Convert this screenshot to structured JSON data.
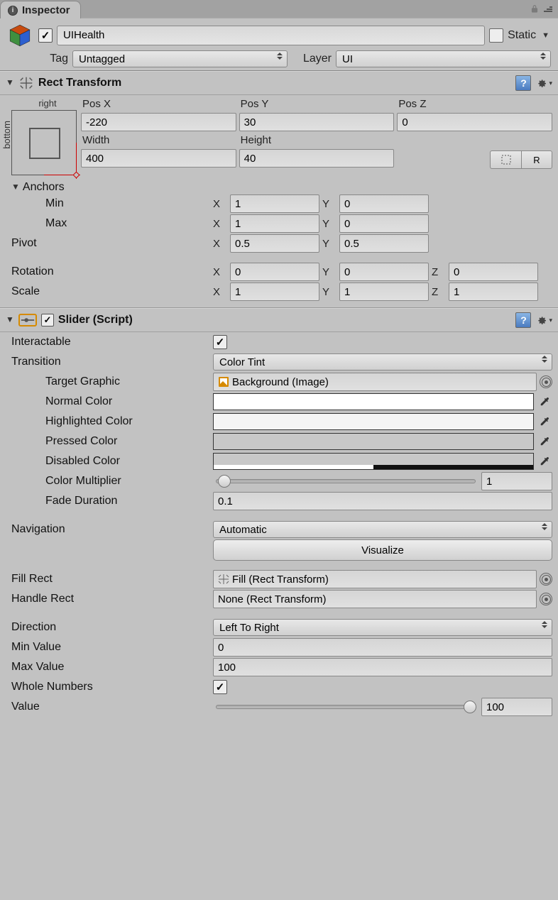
{
  "tab": {
    "title": "Inspector"
  },
  "object": {
    "enabled_checked": "✓",
    "name": "UIHealth",
    "static_label": "Static",
    "tag_label": "Tag",
    "tag_value": "Untagged",
    "layer_label": "Layer",
    "layer_value": "UI"
  },
  "rect_transform": {
    "title": "Rect Transform",
    "anchor_label_top": "right",
    "anchor_label_side": "bottom",
    "posx_label": "Pos X",
    "posx_value": "-220",
    "posy_label": "Pos Y",
    "posy_value": "30",
    "posz_label": "Pos Z",
    "posz_value": "0",
    "width_label": "Width",
    "width_value": "400",
    "height_label": "Height",
    "height_value": "40",
    "anchors_label": "Anchors",
    "min_label": "Min",
    "min_x": "1",
    "min_y": "0",
    "max_label": "Max",
    "max_x": "1",
    "max_y": "0",
    "pivot_label": "Pivot",
    "pivot_x": "0.5",
    "pivot_y": "0.5",
    "rotation_label": "Rotation",
    "rot_x": "0",
    "rot_y": "0",
    "rot_z": "0",
    "scale_label": "Scale",
    "scale_x": "1",
    "scale_y": "1",
    "scale_z": "1",
    "axis_x": "X",
    "axis_y": "Y",
    "axis_z": "Z"
  },
  "slider": {
    "title": "Slider (Script)",
    "enabled_checked": "✓",
    "interactable_label": "Interactable",
    "interactable_checked": "✓",
    "transition_label": "Transition",
    "transition_value": "Color Tint",
    "target_graphic_label": "Target Graphic",
    "target_graphic_value": "Background (Image)",
    "normal_color_label": "Normal Color",
    "normal_color_value": "#ffffff",
    "highlighted_color_label": "Highlighted Color",
    "highlighted_color_value": "#f5f5f5",
    "pressed_color_label": "Pressed Color",
    "pressed_color_value": "#c8c8c8",
    "disabled_color_label": "Disabled Color",
    "disabled_color_value": "#c8c8c8",
    "disabled_color_alpha": 0.5,
    "color_multiplier_label": "Color Multiplier",
    "color_multiplier_value": "1",
    "fade_duration_label": "Fade Duration",
    "fade_duration_value": "0.1",
    "navigation_label": "Navigation",
    "navigation_value": "Automatic",
    "visualize_label": "Visualize",
    "fill_rect_label": "Fill Rect",
    "fill_rect_value": "Fill (Rect Transform)",
    "handle_rect_label": "Handle Rect",
    "handle_rect_value": "None (Rect Transform)",
    "direction_label": "Direction",
    "direction_value": "Left To Right",
    "min_value_label": "Min Value",
    "min_value_value": "0",
    "max_value_label": "Max Value",
    "max_value_value": "100",
    "whole_numbers_label": "Whole Numbers",
    "whole_numbers_checked": "✓",
    "value_label": "Value",
    "value_value": "100"
  },
  "tool_btn_r": "R"
}
